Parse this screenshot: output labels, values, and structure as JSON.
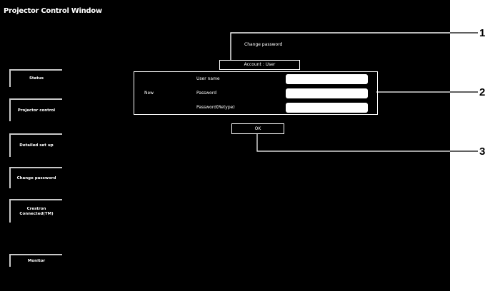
{
  "window": {
    "title": "Projector Control Window"
  },
  "sidebar": {
    "items": [
      {
        "label": "Status"
      },
      {
        "label": "Projector control"
      },
      {
        "label": "Detailed set up"
      },
      {
        "label": "Change password"
      },
      {
        "label": "Crestron Connected(TM)"
      },
      {
        "label": "Monitor"
      }
    ]
  },
  "main": {
    "heading": "Change password",
    "account_label": "Account : User",
    "new_label": "New",
    "fields": [
      {
        "label": "User name",
        "value": ""
      },
      {
        "label": "Password",
        "value": ""
      },
      {
        "label": "Password(Retype)",
        "value": ""
      }
    ],
    "ok_label": "OK"
  },
  "callouts": [
    "1",
    "2",
    "3"
  ]
}
